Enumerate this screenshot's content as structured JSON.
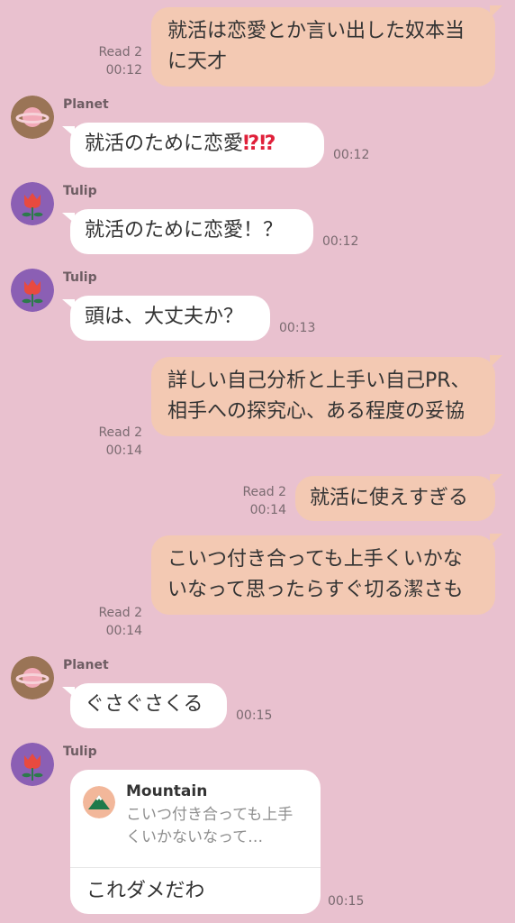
{
  "messages": [
    {
      "type": "out",
      "text": "就活は恋愛とか言い出した奴本当に天才",
      "read": "Read 2",
      "time": "00:12"
    },
    {
      "type": "in",
      "sender": "Planet",
      "text": "就活のために恋愛",
      "emoji": "⁉⁉",
      "time": "00:12"
    },
    {
      "type": "in",
      "sender": "Tulip",
      "text": "就活のために恋愛！？",
      "time": "00:12"
    },
    {
      "type": "in",
      "sender": "Tulip",
      "text": "頭は、大丈夫か？",
      "time": "00:13"
    },
    {
      "type": "out",
      "text": "詳しい自己分析と上手い自己PR、相手への探究心、ある程度の妥協",
      "read": "Read 2",
      "time": "00:14"
    },
    {
      "type": "out",
      "text": "就活に使えすぎる",
      "read": "Read 2",
      "time": "00:14"
    },
    {
      "type": "out",
      "text": "こいつ付き合っても上手くいかないなって思ったらすぐ切る潔さも",
      "read": "Read 2",
      "time": "00:14"
    },
    {
      "type": "in",
      "sender": "Planet",
      "text": "ぐさぐさくる",
      "time": "00:15"
    },
    {
      "type": "reply",
      "sender": "Tulip",
      "quote_sender": "Mountain",
      "quote_text": "こいつ付き合っても上手くいかないなって…",
      "text": "これダメだわ",
      "time": "00:15"
    }
  ],
  "colors": {
    "background": "#e9c1cf",
    "outgoing_bubble": "#f3c9b3",
    "incoming_bubble": "#ffffff"
  },
  "avatars": {
    "Planet": "planet-icon",
    "Tulip": "tulip-icon",
    "Mountain": "mountain-icon"
  }
}
